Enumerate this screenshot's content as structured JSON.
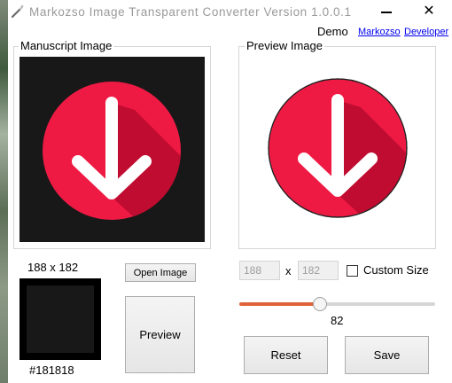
{
  "window": {
    "title": "Markozso Image Transparent Converter Version 1.0.0.1",
    "minimize_icon": "minimize-icon",
    "close_symbol": "✕"
  },
  "links": {
    "demo": "Demo",
    "markozso": "Markozso",
    "developer": "Developer"
  },
  "manuscript": {
    "title": "Manuscript Image",
    "background_color": "#181818",
    "size_label": "188 x 182"
  },
  "preview": {
    "title": "Preview Image"
  },
  "color": {
    "hex_label": "#181818",
    "swatch": "#181818"
  },
  "buttons": {
    "open_image": "Open Image",
    "preview": "Preview",
    "reset": "Reset",
    "save": "Save"
  },
  "size": {
    "width": "188",
    "height": "182",
    "times": "x",
    "custom_size_label": "Custom Size",
    "custom_size_checked": false
  },
  "slider": {
    "value": "82",
    "fraction": 0.41,
    "fill_color": "#e0623a"
  },
  "icons": {
    "app": "magic-wand-icon",
    "download_arrow": "download-arrow-icon"
  },
  "colors": {
    "circle_red": "#ef1a44",
    "circle_shadow": "#bf0c30",
    "arrow_white": "#ffffff"
  }
}
